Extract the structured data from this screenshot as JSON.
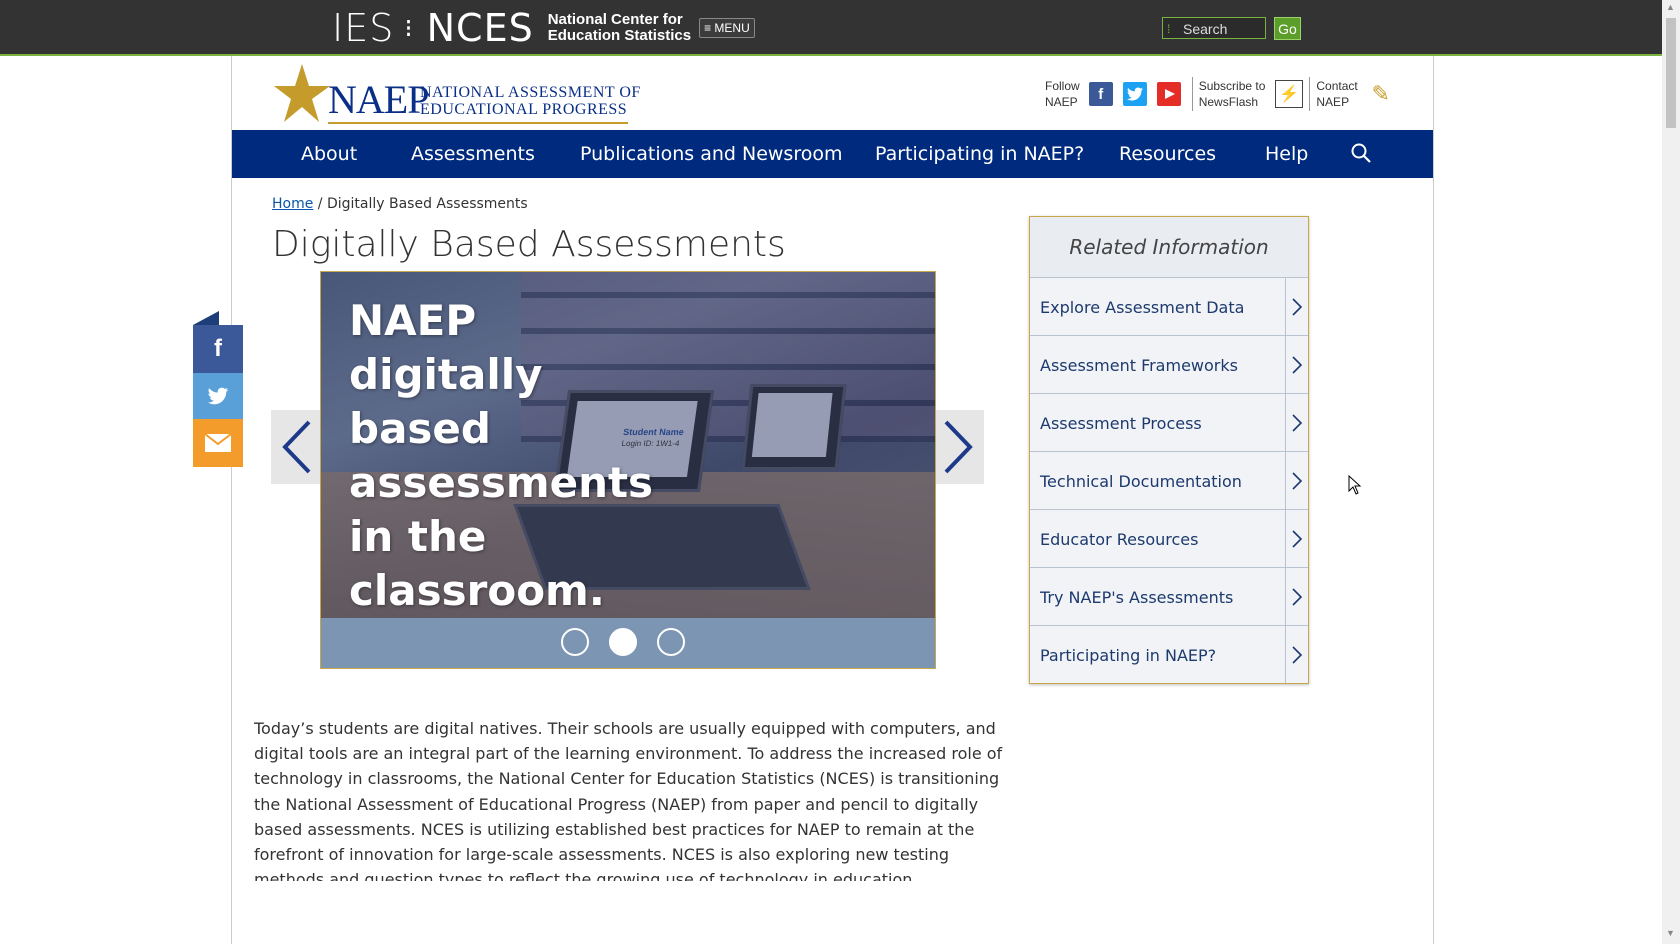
{
  "ies_bar": {
    "ies": "IES",
    "nces": "NCES",
    "nces_full_line1": "National Center for",
    "nces_full_line2": "Education Statistics",
    "menu_label": "≡ MENU",
    "search_placeholder": "Search",
    "go_label": "Go"
  },
  "header": {
    "logo_word": "NAEP",
    "logo_sub_line1": "NATIONAL ASSESSMENT OF",
    "logo_sub_line2": "EDUCATIONAL PROGRESS",
    "follow_line1": "Follow",
    "follow_line2": "NAEP",
    "subscribe_line1": "Subscribe to",
    "subscribe_line2": "NewsFlash",
    "contact_line1": "Contact",
    "contact_line2": "NAEP"
  },
  "nav": {
    "items": [
      {
        "label": "About"
      },
      {
        "label": "Assessments"
      },
      {
        "label": "Publications and Newsroom"
      },
      {
        "label": "Participating in NAEP?"
      },
      {
        "label": "Resources"
      },
      {
        "label": "Help"
      }
    ]
  },
  "breadcrumb": {
    "home": "Home",
    "separator": "/",
    "current": "Digitally Based Assessments"
  },
  "page_title": "Digitally Based Assessments",
  "carousel": {
    "slide_text": "NAEP digitally based assessments in the classroom.",
    "laptop_text_1": "Student Name",
    "laptop_text_2": "Login ID: 1W1-4",
    "dot_count": 3,
    "active_dot": 2
  },
  "related": {
    "title": "Related Information",
    "items": [
      {
        "label": "Explore Assessment Data"
      },
      {
        "label": "Assessment Frameworks"
      },
      {
        "label": "Assessment Process"
      },
      {
        "label": "Technical Documentation"
      },
      {
        "label": "Educator Resources"
      },
      {
        "label": "Try NAEP's Assessments"
      },
      {
        "label": "Participating in NAEP?"
      }
    ]
  },
  "body_text": "Today’s students are digital natives. Their schools are usually equipped with computers, and digital tools are an integral part of the learning environment. To address the increased role of technology in classrooms, the National Center for Education Statistics (NCES) is transitioning the National Assessment of Educational Progress (NAEP) from paper and pencil to digitally based assessments. NCES is utilizing established best practices for NAEP to remain at the forefront of innovation for large-scale assessments. NCES is also exploring new testing methods and question types to reflect the growing use of technology in education.",
  "colors": {
    "nav_bg": "#002a7d",
    "top_bar": "#333333",
    "accent_green": "#7ab33f",
    "gold": "#c59b2b",
    "facebook": "#3b5998",
    "twitter": "#1da1f2",
    "youtube": "#e52d27",
    "email": "#f39c2c"
  },
  "icons": {
    "share": [
      "facebook-icon",
      "twitter-icon",
      "email-icon"
    ],
    "header": [
      "facebook-icon",
      "twitter-icon",
      "youtube-icon",
      "newsflash-icon",
      "contact-icon"
    ]
  }
}
